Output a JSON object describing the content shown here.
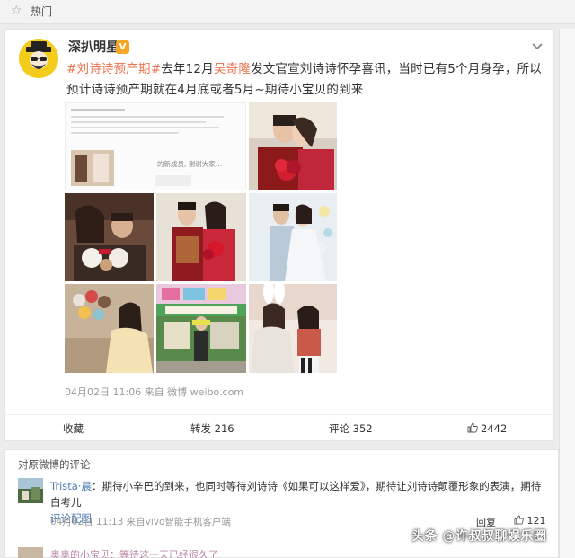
{
  "hotbar": {
    "label": "热门",
    "icon": "star-icon"
  },
  "post": {
    "author": "深扒明星",
    "verified_badge": "V",
    "text": {
      "tag": "#刘诗诗预产期#",
      "part1": "去年12月",
      "mention": "吴奇隆",
      "part2": "发文官宣刘诗诗怀孕喜讯，当时已有5个月身孕，所以预计诗诗预产期就在4月底或者5月~期待小宝贝的到来"
    },
    "photos": [
      {
        "name": "photo-weibo-screenshot",
        "desc": "screenshot"
      },
      {
        "name": "photo-couple-kiss-red"
      },
      {
        "name": "photo-couple-puppies"
      },
      {
        "name": "photo-wedding-red-outfits"
      },
      {
        "name": "photo-wedding-white-suit"
      },
      {
        "name": "photo-plush-toys"
      },
      {
        "name": "photo-street-shop"
      },
      {
        "name": "photo-bunny-ears"
      }
    ],
    "screenshot_lines": [
      "的新成员, 谢谢大家…"
    ],
    "meta": "04月02日 11:06 来自 微博 weibo.com"
  },
  "actions": {
    "collect": "收藏",
    "repost": "转发 216",
    "comment": "评论 352",
    "like": "2442"
  },
  "comments": {
    "heading": "对原微博的评论",
    "items": [
      {
        "user": "Trista·晨",
        "text": "：期待小辛巴的到来，也同时等待刘诗诗《如果可以这样爱》，期待让刘诗诗颠覆形象的表演，期待白考儿",
        "link": "评论配图",
        "meta": "04月02日 11:13 来自vivo智能手机客户端",
        "reply": "回复",
        "likes": "121"
      }
    ],
    "partial_next": "奥奥的小宝贝：等待这一天已经很久了"
  },
  "watermark": "头条 @许叔叔聊娱乐圈",
  "colors": {
    "accent": "#eb7350",
    "link": "#4a7ab3",
    "badge": "#f5a623"
  }
}
